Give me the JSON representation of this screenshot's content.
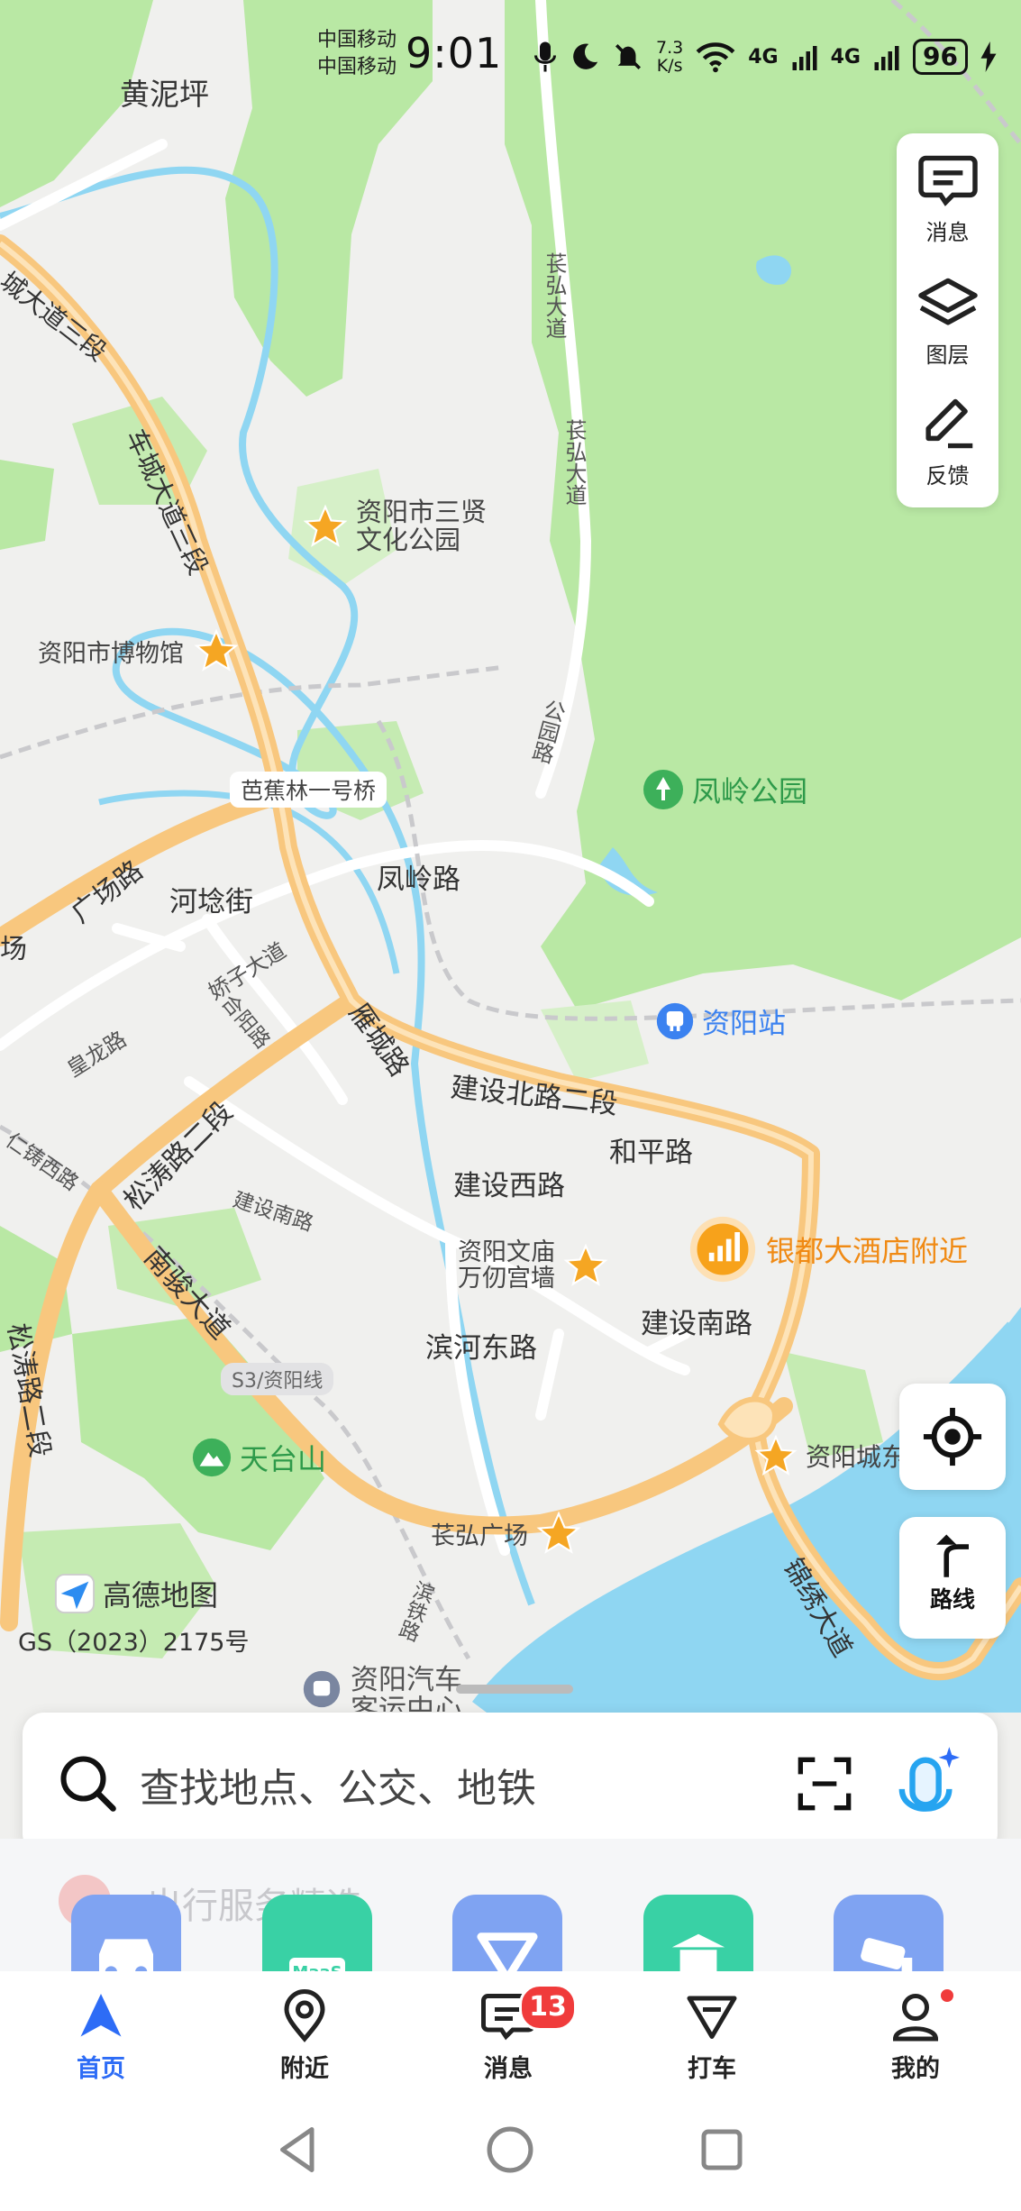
{
  "status_bar": {
    "carrier_1": "中国移动",
    "carrier_2": "中国移动",
    "time": "9:01",
    "net_speed_value": "7.3",
    "net_speed_unit": "K/s",
    "network_1": "4G",
    "network_2": "4G",
    "battery": "96"
  },
  "map": {
    "labels": {
      "huangniping": "黄泥坪",
      "changhong_1": "苌弘大道",
      "changhong_2": "苌弘大道",
      "chengcheng": "车城大道三段",
      "chengcheng_left": "城大道三段",
      "sanxian_1": "资阳市三贤",
      "sanxian_2": "文化公园",
      "museum": "资阳市博物馆",
      "gongyuan_rd": "公园路",
      "fengling_park": "凤岭公园",
      "bajiaolin_bridge": "芭蕉林一号桥",
      "guangchang_rd": "广场路",
      "chang_left": "场",
      "helin_st": "河埝街",
      "fengling_rd": "凤岭路",
      "jiaozi": "娇子大道",
      "heyang": "合阳路",
      "huanglong": "皇龙路",
      "yancheng": "雁城路",
      "ziyang_station": "资阳站",
      "jianshe_north": "建设北路二段",
      "heping": "和平路",
      "jianshe_west": "建设西路",
      "songtao_2": "松涛路二段",
      "renzhu_west": "仁铸西路",
      "jianshe_south_small": "建设南路",
      "wenmiao_1": "资阳文庙",
      "wenmiao_2": "万仞宫墙",
      "hotel": "银都大酒店附近",
      "jianshe_south": "建设南路",
      "binhe_east": "滨河东路",
      "nanjun": "南骏大道",
      "songtao_left": "松涛路二段",
      "s3_line": "S3/资阳线",
      "tiantai": "天台山",
      "ziyang_east": "资阳城东",
      "changhong_square": "苌弘广场",
      "jinxiu": "锦绣大道",
      "binjiang_rd": "滨铁路",
      "bus_station_1": "资阳汽车",
      "bus_station_2": "客运中心"
    }
  },
  "side_panel": {
    "messages": "消息",
    "layers": "图层",
    "feedback": "反馈"
  },
  "route_button": "路线",
  "attribution": {
    "logo_text": "高德地图",
    "license": "GS（2023）2175号"
  },
  "search": {
    "placeholder": "查找地点、公交、地铁"
  },
  "services": {
    "title": "出行服务精选",
    "icons": [
      "car-icon",
      "maas-bus-icon",
      "taxi-icon",
      "scenic-icon",
      "camera-icon"
    ],
    "maas_label": "MaaS"
  },
  "tabs": [
    {
      "label": "首页",
      "active": true
    },
    {
      "label": "附近"
    },
    {
      "label": "消息",
      "badge": "13"
    },
    {
      "label": "打车"
    },
    {
      "label": "我的"
    }
  ],
  "colors": {
    "accent": "#2d6cf6",
    "park": "#b9e8a4",
    "road_main": "#f8c77e",
    "water": "#8fd6f2"
  }
}
